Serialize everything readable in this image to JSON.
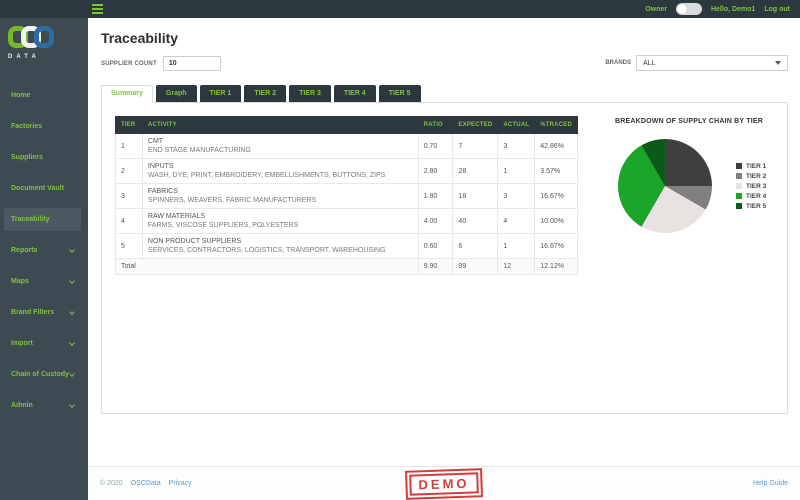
{
  "topbar": {
    "owner_label": "Owner",
    "toggle_state": "off",
    "greeting": "Hello, Demo1",
    "logout_label": "Log out"
  },
  "logo": {
    "brand": "OSC",
    "data_label": "DATA"
  },
  "sidebar": {
    "items": [
      {
        "label": "Home",
        "active": false,
        "submenu": false
      },
      {
        "label": "Factories",
        "active": false,
        "submenu": false
      },
      {
        "label": "Suppliers",
        "active": false,
        "submenu": false
      },
      {
        "label": "Document Vault",
        "active": false,
        "submenu": false
      },
      {
        "label": "Traceability",
        "active": true,
        "submenu": false
      },
      {
        "label": "Reports",
        "active": false,
        "submenu": true
      },
      {
        "label": "Maps",
        "active": false,
        "submenu": true
      },
      {
        "label": "Brand Filters",
        "active": false,
        "submenu": true
      },
      {
        "label": "Import",
        "active": false,
        "submenu": true
      },
      {
        "label": "Chain of Custody",
        "active": false,
        "submenu": true
      },
      {
        "label": "Admin",
        "active": false,
        "submenu": true
      }
    ]
  },
  "page": {
    "title": "Traceability"
  },
  "filters": {
    "supplier_count_label": "SUPPLIER COUNT",
    "supplier_count_value": "10",
    "brands_label": "BRANDS",
    "brands_value": "ALL"
  },
  "tabs": [
    {
      "label": "Summary",
      "active": true
    },
    {
      "label": "Graph",
      "active": false
    },
    {
      "label": "TIER 1",
      "active": false
    },
    {
      "label": "TIER 2",
      "active": false
    },
    {
      "label": "TIER 3",
      "active": false
    },
    {
      "label": "TIER 4",
      "active": false
    },
    {
      "label": "TIER 5",
      "active": false
    }
  ],
  "table": {
    "headers": [
      "TIER",
      "ACTIVITY",
      "RATIO",
      "EXPECTED",
      "ACTUAL",
      "%TRACED"
    ],
    "rows": [
      {
        "tier": "1",
        "activity": "CMT",
        "detail": "END STAGE MANUFACTURING",
        "ratio": "0.70",
        "expected": "7",
        "actual": "3",
        "traced": "42.86%"
      },
      {
        "tier": "2",
        "activity": "INPUTS",
        "detail": "WASH, DYE, PRINT, EMBROIDERY, EMBELLISHMENTS, BUTTONS, ZIPS",
        "ratio": "2.80",
        "expected": "28",
        "actual": "1",
        "traced": "3.57%"
      },
      {
        "tier": "3",
        "activity": "FABRICS",
        "detail": "SPINNERS, WEAVERS, FABRIC MANUFACTURERS",
        "ratio": "1.80",
        "expected": "18",
        "actual": "3",
        "traced": "16.67%"
      },
      {
        "tier": "4",
        "activity": "RAW MATERIALS",
        "detail": "FARMS, VISCOSE SUPPLIERS, POLYESTERS",
        "ratio": "4.00",
        "expected": "40",
        "actual": "4",
        "traced": "10.00%"
      },
      {
        "tier": "5",
        "activity": "NON PRODUCT SUPPLIERS",
        "detail": "SERVICES, CONTRACTORS, LOGISTICS, TRANSPORT, WAREHOUSING",
        "ratio": "0.60",
        "expected": "6",
        "actual": "1",
        "traced": "16.67%"
      }
    ],
    "total": {
      "label": "Total",
      "ratio": "9.90",
      "expected": "99",
      "actual": "12",
      "traced": "12.12%"
    }
  },
  "chart_data": {
    "type": "pie",
    "title": "BREAKDOWN OF SUPPLY CHAIN BY TIER",
    "labels": [
      "TIER 1",
      "TIER 2",
      "TIER 3",
      "TIER 4",
      "TIER 5"
    ],
    "values": [
      3,
      1,
      3,
      4,
      1
    ],
    "percentages": [
      25.0,
      8.33,
      25.0,
      33.33,
      8.33
    ],
    "colors": [
      "#3f3f3f",
      "#808080",
      "#e8e2e1",
      "#1ba62b",
      "#0c5a17"
    ],
    "legend_position": "right",
    "start_angle_deg": 0,
    "direction": "clockwise"
  },
  "footer": {
    "copyright": "© 2020",
    "brand_link": "OSCData",
    "privacy_link": "Privacy",
    "demo_stamp": "DEMO",
    "help_link": "Help Guide"
  },
  "colors": {
    "accent_green": "#7dc242",
    "topbar_charcoal": "#2c373e",
    "sidebar_slate": "#3e4a52",
    "link_blue": "#5b9bd5",
    "demo_red": "#d23c3c"
  }
}
